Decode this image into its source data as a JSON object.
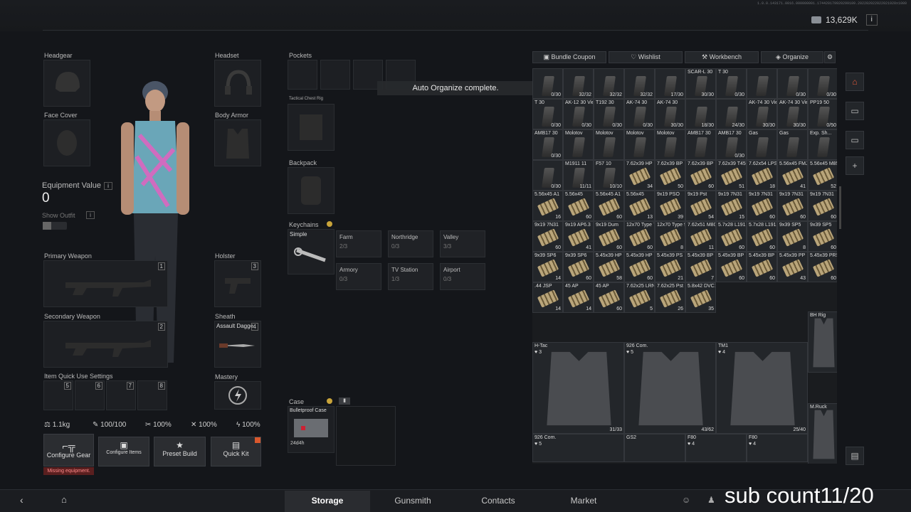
{
  "version_text": "1.0.0.143171.0016.000000001.174420179920299109.202202022022021920x1080",
  "header": {
    "money": "13,629K",
    "info": "i"
  },
  "toast": "Auto Organize complete.",
  "equipment": {
    "headgear": "Headgear",
    "headset": "Headset",
    "face_cover": "Face Cover",
    "body_armor": "Body Armor",
    "equipment_value_label": "Equipment Value",
    "equipment_value": "0",
    "show_outfit": "Show Outfit",
    "primary": "Primary Weapon",
    "primary_num": "1",
    "holster": "Holster",
    "holster_num": "3",
    "secondary": "Secondary Weapon",
    "secondary_num": "2",
    "sheath": "Sheath",
    "sheath_item": "Assault Dagge",
    "sheath_num": "4",
    "quick_use": "Item Quick Use Settings",
    "quick_slots": [
      "5",
      "6",
      "7",
      "8"
    ],
    "mastery": "Mastery"
  },
  "stats": {
    "weight": "1.1kg",
    "durability": "100/100",
    "s2": "100%",
    "s3": "100%",
    "s4": "100%"
  },
  "actions": {
    "configure_gear": "Configure Gear",
    "configure_items": "Configure Items",
    "preset_build": "Preset Build",
    "quick_kit": "Quick Kit",
    "missing": "Missing equipment."
  },
  "storage_left": {
    "pockets": "Pockets",
    "tactical": "Tactical Chest Rig",
    "backpack": "Backpack",
    "keychains": "Keychains",
    "simple": "Simple",
    "keys": [
      {
        "name": "Farm",
        "v": "2/3"
      },
      {
        "name": "Northridge",
        "v": "0/3"
      },
      {
        "name": "Valley",
        "v": "3/3"
      },
      {
        "name": "Armory",
        "v": "0/3"
      },
      {
        "name": "TV Station",
        "v": "1/3"
      },
      {
        "name": "Airport",
        "v": "0/3"
      }
    ],
    "case": "Case",
    "case_item": "Bulletproof Case",
    "case_time": "24d4h"
  },
  "stash_tabs": {
    "bundle": "Bundle Coupon",
    "wishlist": "Wishlist",
    "workbench": "Workbench",
    "organize": "Organize"
  },
  "grid": [
    {
      "t": "",
      "c": "0/30",
      "k": "mag"
    },
    {
      "t": "",
      "c": "32/32",
      "k": "mag"
    },
    {
      "t": "",
      "c": "32/32",
      "k": "mag"
    },
    {
      "t": "",
      "c": "32/32",
      "k": "mag"
    },
    {
      "t": "",
      "c": "17/30",
      "k": "mag"
    },
    {
      "t": "SCAR-L 30",
      "c": "30/30",
      "k": "mag"
    },
    {
      "t": "T 30",
      "c": "0/30",
      "k": "mag"
    },
    {
      "t": "",
      "c": "",
      "k": "mag"
    },
    {
      "t": "",
      "c": "0/30",
      "k": "mag"
    },
    {
      "t": "",
      "c": "0/30",
      "k": "mag"
    },
    {
      "t": "T 30",
      "c": "0/30",
      "k": "mag"
    },
    {
      "t": "AK-12 30 View",
      "c": "0/30",
      "k": "mag"
    },
    {
      "t": "T192 30",
      "c": "0/30",
      "k": "mag"
    },
    {
      "t": "AK-74 30",
      "c": "0/30",
      "k": "mag"
    },
    {
      "t": "AK-74 30",
      "c": "30/30",
      "k": "mag"
    },
    {
      "t": "",
      "c": "18/30",
      "k": "mag"
    },
    {
      "t": "",
      "c": "24/30",
      "k": "mag"
    },
    {
      "t": "AK-74 30 View",
      "c": "30/30",
      "k": "mag"
    },
    {
      "t": "AK-74 30 View",
      "c": "30/30",
      "k": "mag"
    },
    {
      "t": "PP19 50",
      "c": "0/50",
      "k": "mag"
    },
    {
      "t": "AMB17 30",
      "c": "0/30",
      "k": "mag"
    },
    {
      "t": "Molotov",
      "c": "",
      "k": "mag"
    },
    {
      "t": "Molotov",
      "c": "",
      "k": "mag"
    },
    {
      "t": "Molotov",
      "c": "",
      "k": "mag"
    },
    {
      "t": "Molotov",
      "c": "",
      "k": "mag"
    },
    {
      "t": "AMB17 30",
      "c": "",
      "k": "mag"
    },
    {
      "t": "AMB17 30",
      "c": "0/30",
      "k": "mag"
    },
    {
      "t": "Gas",
      "c": "",
      "k": "mag"
    },
    {
      "t": "Gas",
      "c": "",
      "k": "mag"
    },
    {
      "t": "Exp. Sh...",
      "c": "",
      "k": "mag"
    },
    {
      "t": "",
      "c": "0/30",
      "k": "mag"
    },
    {
      "t": "M1911 11",
      "c": "11/11",
      "k": "mag"
    },
    {
      "t": "F57 10",
      "c": "10/10",
      "k": "mag"
    },
    {
      "t": "7.62x39 HP",
      "c": "34",
      "k": "ammo"
    },
    {
      "t": "7.62x39 BP",
      "c": "50",
      "k": "ammo"
    },
    {
      "t": "7.62x39 BP",
      "c": "60",
      "k": "ammo"
    },
    {
      "t": "7.62x39 T45M",
      "c": "51",
      "k": "ammo"
    },
    {
      "t": "7.62x54 LPS",
      "c": "18",
      "k": "ammo"
    },
    {
      "t": "5.56x45 FMJ",
      "c": "41",
      "k": "ammo"
    },
    {
      "t": "5.56x45 M855",
      "c": "52",
      "k": "ammo"
    },
    {
      "t": "5.56x45 A1",
      "c": "16",
      "k": "ammo"
    },
    {
      "t": "5.56x45",
      "c": "60",
      "k": "ammo"
    },
    {
      "t": "5.56x45 A1",
      "c": "60",
      "k": "ammo"
    },
    {
      "t": "5.56x45",
      "c": "13",
      "k": "ammo"
    },
    {
      "t": "9x19 PSO",
      "c": "39",
      "k": "ammo"
    },
    {
      "t": "9x19 Pst",
      "c": "54",
      "k": "ammo"
    },
    {
      "t": "9x19 7N31",
      "c": "15",
      "k": "ammo"
    },
    {
      "t": "9x19 7N31",
      "c": "60",
      "k": "ammo"
    },
    {
      "t": "9x19 7N31",
      "c": "60",
      "k": "ammo"
    },
    {
      "t": "9x19 7N31",
      "c": "60",
      "k": "ammo"
    },
    {
      "t": "9x19 7N31",
      "c": "60",
      "k": "ammo"
    },
    {
      "t": "9x19 AP6.3",
      "c": "41",
      "k": "ammo"
    },
    {
      "t": "9x19 Dum",
      "c": "60",
      "k": "ammo"
    },
    {
      "t": "12x70 Type 7",
      "c": "60",
      "k": "ammo"
    },
    {
      "t": "12x70 Type 9",
      "c": "8",
      "k": "ammo"
    },
    {
      "t": "7.62x51 M80",
      "c": "11",
      "k": "ammo"
    },
    {
      "t": "5.7x28 L191",
      "c": "60",
      "k": "ammo"
    },
    {
      "t": "5.7x28 L191",
      "c": "60",
      "k": "ammo"
    },
    {
      "t": "9x39 SP5",
      "c": "8",
      "k": "ammo"
    },
    {
      "t": "9x39 SP5",
      "c": "60",
      "k": "ammo"
    },
    {
      "t": "9x39 SP6",
      "c": "14",
      "k": "ammo"
    },
    {
      "t": "9x39 SP6",
      "c": "60",
      "k": "ammo"
    },
    {
      "t": "5.45x39 HP",
      "c": "58",
      "k": "ammo"
    },
    {
      "t": "5.45x39 HP",
      "c": "60",
      "k": "ammo"
    },
    {
      "t": "5.45x39 PS",
      "c": "21",
      "k": "ammo"
    },
    {
      "t": "5.45x39 BP",
      "c": "7",
      "k": "ammo"
    },
    {
      "t": "5.45x39 BP",
      "c": "60",
      "k": "ammo"
    },
    {
      "t": "5.45x39 BP",
      "c": "60",
      "k": "ammo"
    },
    {
      "t": "5.45x39 PP",
      "c": "43",
      "k": "ammo"
    },
    {
      "t": "5.45x39 PRS",
      "c": "60",
      "k": "ammo"
    },
    {
      "t": ".44 JSP",
      "c": "14",
      "k": "ammo"
    },
    {
      "t": "45 AP",
      "c": "14",
      "k": "ammo"
    },
    {
      "t": "45 AP",
      "c": "60",
      "k": "ammo"
    },
    {
      "t": "7.62x25 LRN",
      "c": "5",
      "k": "ammo"
    },
    {
      "t": "7.62x25 Pst",
      "c": "26",
      "k": "ammo"
    },
    {
      "t": "5.8x42 DVC12",
      "c": "35",
      "k": "ammo"
    }
  ],
  "armor": [
    {
      "t": "H-Tac",
      "lvl": "3",
      "c": "31/33"
    },
    {
      "t": "926 Com.",
      "lvl": "5",
      "c": "43/62"
    },
    {
      "t": "TM1",
      "lvl": "4",
      "c": "25/40"
    },
    {
      "t": "BH Rig",
      "lvl": "",
      "c": ""
    },
    {
      "t": "M.Ruck",
      "lvl": "",
      "c": ""
    }
  ],
  "bottom_row": [
    {
      "t": "926 Com.",
      "lvl": "5"
    },
    {
      "t": "GS2",
      "lvl": ""
    },
    {
      "t": "F80",
      "lvl": "4"
    },
    {
      "t": "F80",
      "lvl": "4"
    }
  ],
  "nav": {
    "storage": "Storage",
    "gunsmith": "Gunsmith",
    "contacts": "Contacts",
    "market": "Market"
  },
  "overlay": "sub count11/20"
}
